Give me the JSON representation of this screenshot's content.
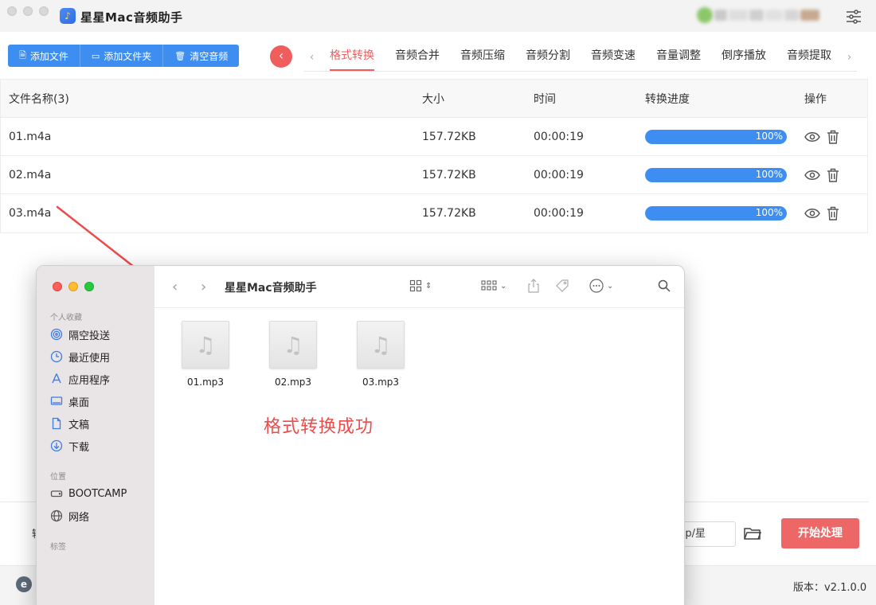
{
  "app": {
    "title": "星星Mac音频助手",
    "accent_color": "#ef5d5d",
    "primary_color": "#3d8ef0"
  },
  "toolbar": {
    "buttons": [
      {
        "label": "添加文件",
        "icon": "file-icon"
      },
      {
        "label": "添加文件夹",
        "icon": "folder-icon"
      },
      {
        "label": "清空音频",
        "icon": "trash-icon"
      }
    ]
  },
  "tabs": [
    {
      "label": "格式转换",
      "active": true
    },
    {
      "label": "音频合并",
      "active": false
    },
    {
      "label": "音频压缩",
      "active": false
    },
    {
      "label": "音频分割",
      "active": false
    },
    {
      "label": "音频变速",
      "active": false
    },
    {
      "label": "音量调整",
      "active": false
    },
    {
      "label": "倒序播放",
      "active": false
    },
    {
      "label": "音频提取",
      "active": false
    }
  ],
  "table": {
    "headers": {
      "name": "文件名称(3)",
      "size": "大小",
      "time": "时间",
      "progress": "转换进度",
      "action": "操作"
    },
    "rows": [
      {
        "name": "01.m4a",
        "size": "157.72KB",
        "time": "00:00:19",
        "progress": "100%",
        "progress_value": 1.0
      },
      {
        "name": "02.m4a",
        "size": "157.72KB",
        "time": "00:00:19",
        "progress": "100%",
        "progress_value": 1.0
      },
      {
        "name": "03.m4a",
        "size": "157.72KB",
        "time": "00:00:19",
        "progress": "100%",
        "progress_value": 1.0
      }
    ]
  },
  "bottom": {
    "output_label": "输",
    "path_value": "esktop/星",
    "start_label": "开始处理",
    "version": "版本：v2.1.0.0"
  },
  "finder": {
    "title": "星星Mac音频助手",
    "sidebar": {
      "favorites_heading": "个人收藏",
      "favorites": [
        {
          "label": "隔空投送",
          "icon": "airdrop-icon"
        },
        {
          "label": "最近使用",
          "icon": "clock-icon"
        },
        {
          "label": "应用程序",
          "icon": "applications-icon"
        },
        {
          "label": "桌面",
          "icon": "desktop-icon"
        },
        {
          "label": "文稿",
          "icon": "document-icon"
        },
        {
          "label": "下载",
          "icon": "download-icon"
        }
      ],
      "locations_heading": "位置",
      "locations": [
        {
          "label": "BOOTCAMP",
          "icon": "drive-icon"
        },
        {
          "label": "网络",
          "icon": "network-icon"
        }
      ],
      "tags_heading": "标签"
    },
    "files": [
      {
        "name": "01.mp3"
      },
      {
        "name": "02.mp3"
      },
      {
        "name": "03.mp3"
      }
    ]
  },
  "annotation": {
    "text": "格式转换成功",
    "color": "#ee4b4b"
  }
}
